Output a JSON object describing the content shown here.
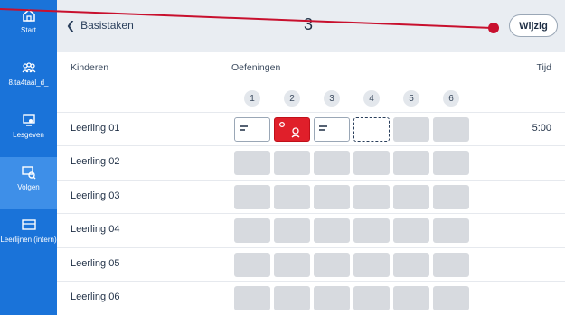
{
  "sidebar": {
    "items": [
      {
        "label": "Start",
        "icon": "home-icon"
      },
      {
        "label": "8.ta4taal_d_",
        "icon": "group-icon"
      },
      {
        "label": "Lesgeven",
        "icon": "teach-icon"
      },
      {
        "label": "Volgen",
        "icon": "monitor-icon"
      },
      {
        "label": "Leerlijnen (intern)",
        "icon": "learning-lines-icon"
      }
    ],
    "color": "#1a73d9",
    "active_color": "#3e8fe8"
  },
  "header": {
    "back_label": "Basistaken",
    "title": "3",
    "edit_button": "Wijzig"
  },
  "table": {
    "columns": {
      "children": "Kinderen",
      "exercises": "Oefeningen",
      "time": "Tijd"
    },
    "exercise_numbers": [
      "1",
      "2",
      "3",
      "4",
      "5",
      "6"
    ],
    "rows": [
      {
        "name": "Leerling 01",
        "time": "5:00",
        "cells": [
          "text-answer",
          "red-feedback",
          "text-answer",
          "current",
          "empty",
          "empty"
        ]
      },
      {
        "name": "Leerling 02",
        "time": "",
        "cells": [
          "empty",
          "empty",
          "empty",
          "empty",
          "empty",
          "empty"
        ]
      },
      {
        "name": "Leerling 03",
        "time": "",
        "cells": [
          "empty",
          "empty",
          "empty",
          "empty",
          "empty",
          "empty"
        ]
      },
      {
        "name": "Leerling 04",
        "time": "",
        "cells": [
          "empty",
          "empty",
          "empty",
          "empty",
          "empty",
          "empty"
        ]
      },
      {
        "name": "Leerling 05",
        "time": "",
        "cells": [
          "empty",
          "empty",
          "empty",
          "empty",
          "empty",
          "empty"
        ]
      },
      {
        "name": "Leerling 06",
        "time": "",
        "cells": [
          "empty",
          "empty",
          "empty",
          "empty",
          "empty",
          "empty"
        ]
      }
    ]
  },
  "colors": {
    "accent_red": "#e01f2a",
    "annotation_red": "#c8102e"
  }
}
